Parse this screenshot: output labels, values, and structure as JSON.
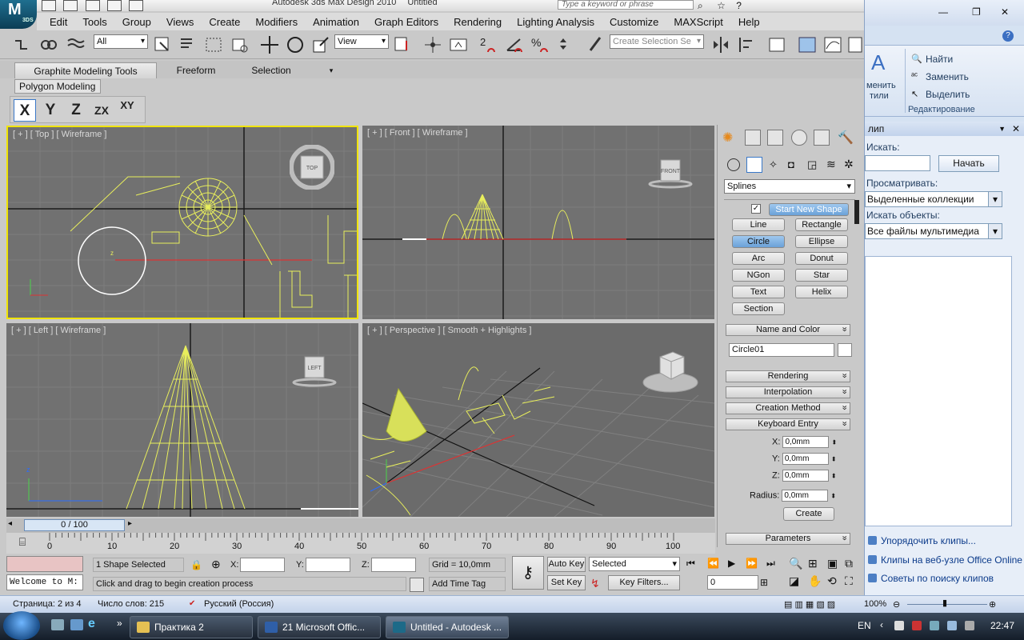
{
  "app": {
    "title_prefix": "Autodesk 3ds Max Design 2010",
    "document": "Untitled",
    "logo_text": "M",
    "logo_badge": "3DS",
    "search_placeholder": "Type a keyword or phrase"
  },
  "menu": [
    "Edit",
    "Tools",
    "Group",
    "Views",
    "Create",
    "Modifiers",
    "Animation",
    "Graph Editors",
    "Rendering",
    "Lighting Analysis",
    "Customize",
    "MAXScript",
    "Help"
  ],
  "toolbar": {
    "selection_filter": "All",
    "reference_coord": "View",
    "named_selection_placeholder": "Create Selection Se",
    "snap_label": "2"
  },
  "ribbon": {
    "tabs": [
      "Graphite Modeling Tools",
      "Freeform",
      "Selection"
    ],
    "subtab": "Polygon Modeling",
    "axis_buttons": [
      "X",
      "Y",
      "Z",
      "ZX",
      "XY"
    ]
  },
  "viewports": {
    "top": {
      "label": "[ + ] [ Top ] [ Wireframe ]",
      "cube": "TOP"
    },
    "front": {
      "label": "[ + ] [ Front ] [ Wireframe ]",
      "cube": "FRONT"
    },
    "left": {
      "label": "[ + ] [ Left ] [ Wireframe ]",
      "cube": "LEFT"
    },
    "perspective": {
      "label": "[ + ] [ Perspective ] [ Smooth + Highlights ]"
    }
  },
  "command_panel": {
    "category": "Splines",
    "start_new_shape": "Start New Shape",
    "object_types": [
      "Line",
      "Rectangle",
      "Circle",
      "Ellipse",
      "Arc",
      "Donut",
      "NGon",
      "Star",
      "Text",
      "Helix",
      "Section"
    ],
    "active_type": "Circle",
    "rollouts": {
      "name_color": "Name and Color",
      "rendering": "Rendering",
      "interpolation": "Interpolation",
      "creation_method": "Creation Method",
      "keyboard_entry": "Keyboard Entry",
      "parameters": "Parameters"
    },
    "object_name": "Circle01",
    "keyboard": {
      "x_label": "X:",
      "x": "0,0mm",
      "y_label": "Y:",
      "y": "0,0mm",
      "z_label": "Z:",
      "z": "0,0mm",
      "radius_label": "Radius:",
      "radius": "0,0mm",
      "create": "Create"
    }
  },
  "timeline": {
    "frame": "0 / 100",
    "ticks": [
      "0",
      "10",
      "20",
      "30",
      "40",
      "50",
      "60",
      "70",
      "80",
      "90",
      "100"
    ]
  },
  "status": {
    "maxscript": "Welcome to M:",
    "selection": "1 Shape Selected",
    "prompt": "Click and drag to begin creation process",
    "x_label": "X:",
    "y_label": "Y:",
    "z_label": "Z:",
    "grid": "Grid = 10,0mm",
    "add_time_tag": "Add Time Tag",
    "auto_key": "Auto Key",
    "set_key": "Set Key",
    "key_mode": "Selected",
    "key_filters": "Key Filters...",
    "frame_field": "0"
  },
  "word_status": {
    "page": "Страница: 2 из 4",
    "words": "Число слов: 215",
    "language": "Русский (Россия)",
    "zoom": "100%"
  },
  "word_panel": {
    "find": "Найти",
    "replace": "Заменить",
    "select": "Выделить",
    "group_editing": "Редактирование",
    "styles_line1": "менить",
    "styles_line2": "тили",
    "clip_title": "лип",
    "search_label": "Искать:",
    "start_btn": "Начать",
    "browse_label": "Просматривать:",
    "browse_value": "Выделенные коллекции",
    "objects_label": "Искать объекты:",
    "objects_value": "Все файлы мультимедиа",
    "links": [
      "Упорядочить клипы...",
      "Клипы на веб-узле Office Online",
      "Советы по поиску клипов"
    ]
  },
  "taskbar": {
    "tasks": [
      "Практика 2",
      "21 Microsoft Offic...",
      "Untitled - Autodesk ..."
    ],
    "lang": "EN",
    "time": "22:47"
  },
  "colors": {
    "wire": "#e8ee5c",
    "viewport_bg": "#717171",
    "active_border": "#f0e400"
  }
}
